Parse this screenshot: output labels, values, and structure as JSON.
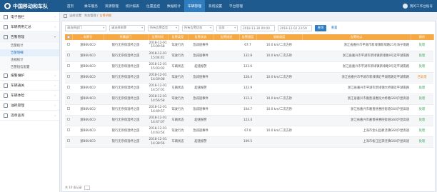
{
  "brand": {
    "title": "中国移动和车队"
  },
  "nav": [
    "首页",
    "乘车服务",
    "资源管理",
    "统计报表",
    "位置监控",
    "数据统计",
    "车辆管理",
    "系统设置",
    "平台管理"
  ],
  "nav_active_index": 6,
  "user": {
    "name": "我的工作台账号"
  },
  "sidebar": {
    "items": [
      {
        "label": "电子围栏"
      },
      {
        "label": "车辆费用汇总"
      },
      {
        "label": "告警管理",
        "open": true,
        "subs": [
          "告警统计",
          "告警明细",
          "违规统计",
          "告警短信配置"
        ],
        "active_sub": 1
      },
      {
        "label": "报警维护"
      },
      {
        "label": "车辆通关"
      },
      {
        "label": "车辆体检"
      },
      {
        "label": "油耗管理"
      },
      {
        "label": "违章查询"
      }
    ]
  },
  "breadcrumb": {
    "path": "当前位置：车务管理 / ",
    "tab": "告警明细"
  },
  "filters": {
    "dept": "请选择部门",
    "plate": "请选择车牌",
    "alarm_type": "所有告警类型",
    "alarm_state": "所有告警状态",
    "all": "全部",
    "start": "2018-11-30 00:00",
    "end": "2018-12-02 23:59",
    "search": "查询",
    "reset": "重置"
  },
  "table": {
    "headers": [
      "",
      "车牌号",
      "所属部门",
      "告警时间",
      "告警类型",
      "告警状态",
      "告警描述",
      "告警速度",
      "限制速度",
      "告警地点",
      "操作"
    ],
    "rows": [
      [
        "浙B6U6C0",
        "银行无序保温杯之旅",
        "2018-12-01 15:09:58",
        "驾驶行为",
        "急减速事件",
        "",
        "67.7",
        "10.0 km/二次方秒",
        "浙江省嘉兴市平湖市新埭镇新埭路21号海宁南路",
        "处理"
      ],
      [
        "浙B6U6C0",
        "银行无序保温杯之旅",
        "2018-12-01 15:04:41",
        "驾驶行为",
        "急减速事件",
        "",
        "132.8",
        "10.0 km/二次方秒",
        "浙江省嘉兴市平湖市新埭镇新埭路9号近平湖南路",
        "处理"
      ],
      [
        "浙B6U6C0",
        "银行无序保温杯之旅",
        "2018-12-01 15:03:02",
        "车辆状态",
        "超速报警",
        "",
        "123.6",
        "",
        "浙江省嘉兴市平湖市新埭镇新埭路9号近平湖南路",
        "处理"
      ],
      [
        "浙B6U6C0",
        "银行无序保温杯之旅",
        "2018-12-01 14:59:08",
        "驾驶行为",
        "急减速事件",
        "",
        "128.4",
        "10.0 km/二次方秒",
        "浙江省嘉兴市平湖市新埭镇近平湖南路近平湖南路",
        "已处理"
      ],
      [
        "浙B6U6C0",
        "银行无序保温杯之旅",
        "2018-12-01 14:57:01",
        "车辆状态",
        "超速报警",
        "",
        "122.9",
        "",
        "浙江省嘉兴市平湖市新埭镇大桥镇近平湖南路",
        "处理"
      ],
      [
        "浙B6U6C0",
        "银行无序保温杯之旅",
        "2018-12-01 14:56:58",
        "驾驶行为",
        "急减速事件",
        "",
        "112.3",
        "10.0 km/二次方秒",
        "浙江省嘉兴市嘉善县惠民大桥路G60沪昆高速",
        "处理"
      ],
      [
        "浙B6U6C0",
        "银行无序保温杯之旅",
        "2018-12-01 14:49:57",
        "驾驶行为",
        "急减速事件",
        "",
        "104.7",
        "10.0 km/二次方秒",
        "浙江省嘉兴市嘉善县惠民街道G60沪昆高速",
        "处理"
      ],
      [
        "浙B6U6C0",
        "银行无序保温杯之旅",
        "2018-12-01 14:47:07",
        "车辆状态",
        "超速报警",
        "",
        "123.4",
        "",
        "浙江省嘉兴市嘉善县惠民街道G60沪昆高速",
        "处理"
      ],
      [
        "浙B6U6C0",
        "银行无序保温杯之旅",
        "2018-12-01 14:43:54",
        "驾驶行为",
        "急减速事件",
        "",
        "67.8",
        "10.0 km/二次方秒",
        "上海市金山区枫泾镇G60沪昆高速",
        "处理"
      ],
      [
        "浙B6U6C0",
        "银行无序保温杯之旅",
        "2018-12-01 14:38:56",
        "车辆状态",
        "超速报警",
        "",
        "109.5",
        "",
        "上海市松江区泗泾镇G60沪昆高速",
        "处理"
      ]
    ]
  },
  "pager": {
    "text": "共 10 条记录"
  }
}
